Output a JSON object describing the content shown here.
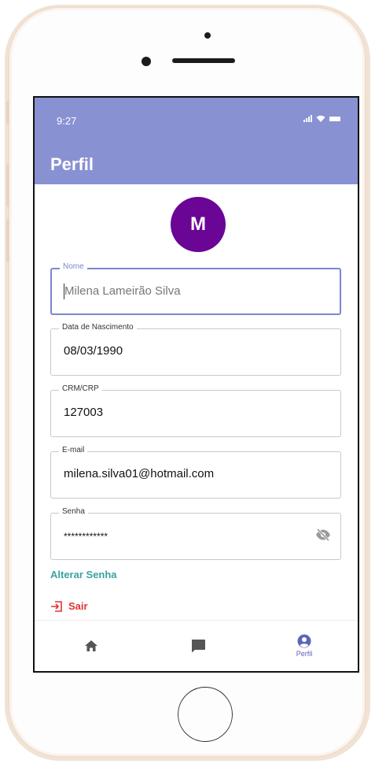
{
  "status_bar": {
    "time": "9:27"
  },
  "header": {
    "title": "Perfil"
  },
  "profile": {
    "avatar_initial": "M"
  },
  "form": {
    "name": {
      "label": "Nome",
      "value": "Milena Lameirão Silva"
    },
    "birthdate": {
      "label": "Data de Nascimento",
      "value": "08/03/1990"
    },
    "crm": {
      "label": "CRM/CRP",
      "value": "127003"
    },
    "email": {
      "label": "E-mail",
      "value": "milena.silva01@hotmail.com"
    },
    "password": {
      "label": "Senha",
      "value": "************",
      "visibility_icon": "eye-off-icon"
    }
  },
  "actions": {
    "change_password": "Alterar Senha",
    "logout": "Sair"
  },
  "tabbar": {
    "items": [
      {
        "icon": "home-icon",
        "label": ""
      },
      {
        "icon": "chat-icon",
        "label": ""
      },
      {
        "icon": "user-circle-icon",
        "label": "Perfil",
        "active": true
      }
    ]
  },
  "colors": {
    "header": "#8891d2",
    "avatar": "#6a0595",
    "link": "#3aa3a0",
    "logout": "#e33232",
    "focus": "#7b86d3"
  }
}
